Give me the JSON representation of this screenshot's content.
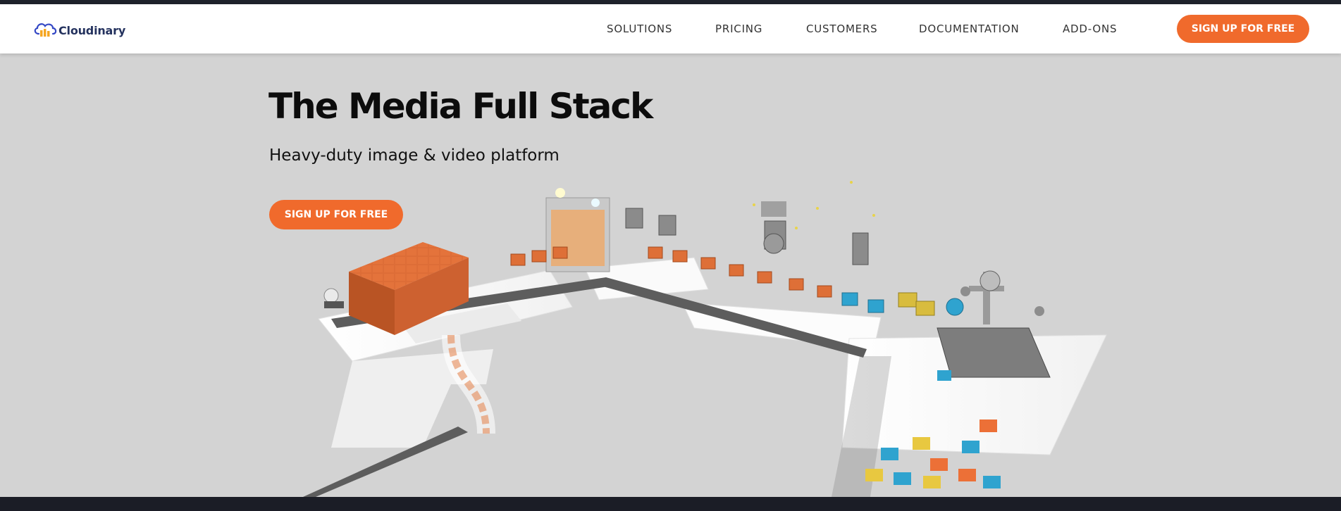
{
  "brand": {
    "name": "Cloudinary"
  },
  "nav": {
    "items": [
      {
        "label": "SOLUTIONS"
      },
      {
        "label": "PRICING"
      },
      {
        "label": "CUSTOMERS"
      },
      {
        "label": "DOCUMENTATION"
      },
      {
        "label": "ADD-ONS"
      }
    ],
    "cta_label": "SIGN UP FOR FREE"
  },
  "hero": {
    "title": "The Media Full Stack",
    "subtitle": "Heavy-duty image & video platform",
    "cta_label": "SIGN UP FOR FREE"
  },
  "colors": {
    "accent": "#f06a2c",
    "background": "#d3d3d3",
    "dark": "#1e222b",
    "logo_blue": "#3448c5"
  },
  "icons": [
    "cloudinary-logo-icon",
    "conveyor-illustration"
  ]
}
